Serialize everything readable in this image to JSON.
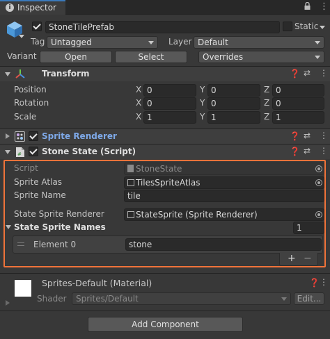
{
  "tab": {
    "title": "Inspector",
    "icon": "info-icon"
  },
  "object": {
    "name": "StoneTilePrefab",
    "static_label": "Static",
    "tag_label": "Tag",
    "tag_value": "Untagged",
    "layer_label": "Layer",
    "layer_value": "Default"
  },
  "variant": {
    "label": "Variant",
    "open": "Open",
    "select": "Select",
    "overrides": "Overrides"
  },
  "transform": {
    "title": "Transform",
    "rows": [
      {
        "label": "Position",
        "x": "0",
        "y": "0",
        "z": "0"
      },
      {
        "label": "Rotation",
        "x": "0",
        "y": "0",
        "z": "0"
      },
      {
        "label": "Scale",
        "x": "1",
        "y": "1",
        "z": "1"
      }
    ],
    "axis": {
      "x": "X",
      "y": "Y",
      "z": "Z"
    }
  },
  "sprite_renderer": {
    "title": "Sprite Renderer"
  },
  "stone_state": {
    "title": "Stone State (Script)",
    "script_label": "Script",
    "script_value": "StoneState",
    "atlas_label": "Sprite Atlas",
    "atlas_value": "TilesSpriteAtlas",
    "name_label": "Sprite Name",
    "name_value": "tile",
    "renderer_label": "State Sprite Renderer",
    "renderer_value": "StateSprite (Sprite Renderer)",
    "names_label": "State Sprite Names",
    "names_count": "1",
    "element_label": "Element 0",
    "element_value": "stone",
    "plus": "+",
    "minus": "−"
  },
  "material": {
    "title": "Sprites-Default (Material)",
    "shader_label": "Shader",
    "shader_value": "Sprites/Default",
    "edit": "Edit..."
  },
  "add_component": "Add Component",
  "colors": {
    "accent_highlight": "#f0733a",
    "link_blue": "#7ea9e8",
    "background": "#383838"
  }
}
